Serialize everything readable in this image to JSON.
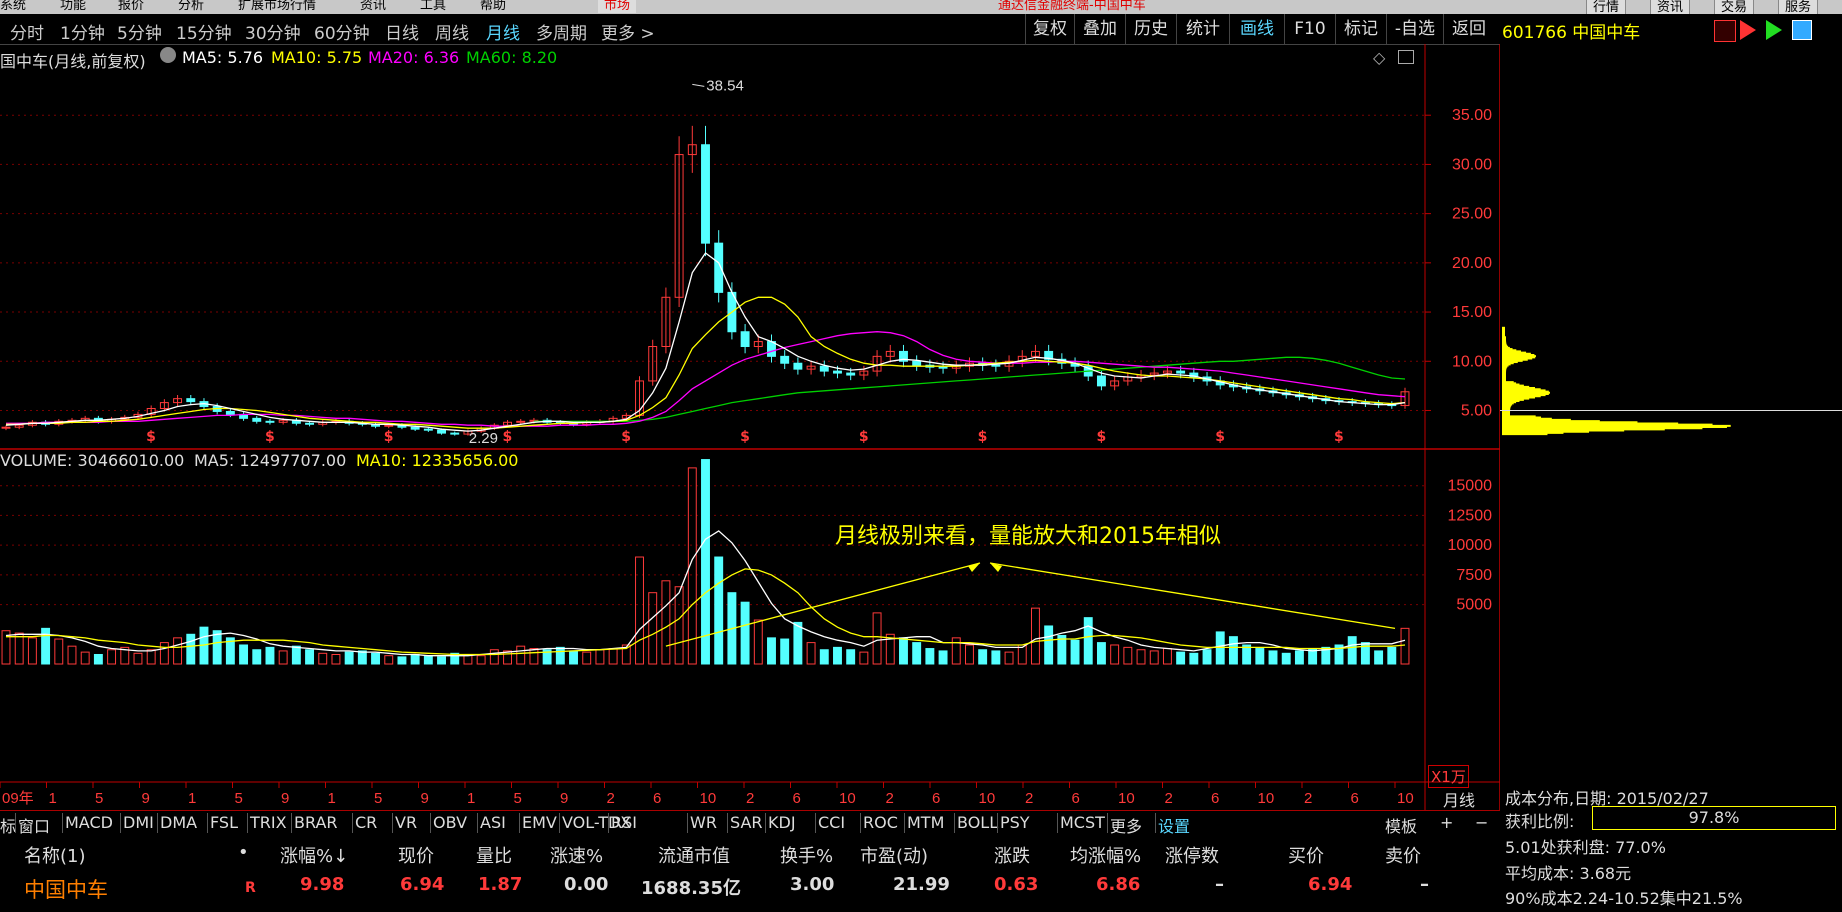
{
  "menu": {
    "items": [
      "系统",
      "功能",
      "报价",
      "分析",
      "扩展市场行情",
      "资讯",
      "工具",
      "帮助"
    ],
    "red_tag": "市场",
    "red_title": "通达信金融终端-中国中车",
    "right_buttons": [
      "行情",
      "资讯",
      "交易",
      "服务"
    ]
  },
  "periods": [
    "分时",
    "1分钟",
    "5分钟",
    "15分钟",
    "30分钟",
    "60分钟",
    "日线",
    "周线",
    "月线",
    "多周期",
    "更多 >"
  ],
  "active_period": "月线",
  "toolbar": [
    "复权",
    "叠加",
    "历史",
    "统计",
    "画线",
    "F10",
    "标记",
    "-自选",
    "返回"
  ],
  "highlighted_tool": "画线",
  "stock": {
    "code": "601766",
    "name": "中国中车",
    "header": "601766 中国中车"
  },
  "price_legend": {
    "title": "国中车(月线,前复权)",
    "ma5": "MA5: 5.76",
    "ma10": "MA10: 5.75",
    "ma20": "MA20: 6.36",
    "ma60": "MA60: 8.20"
  },
  "volume_legend": {
    "vol": "VOLUME: 30466010.00",
    "ma5": "MA5: 12497707.00",
    "ma10": "MA10: 12335656.00"
  },
  "annotation": "月线极别来看，量能放大和2015年相似",
  "volume_unit": "X1万",
  "period_label": "月线",
  "x_axis_labels": [
    "09年",
    "1",
    "5",
    "9",
    "1",
    "5",
    "9",
    "1",
    "5",
    "9",
    "1",
    "5",
    "9",
    "2",
    "6",
    "10",
    "2",
    "6",
    "10",
    "2",
    "6",
    "10",
    "2",
    "6",
    "10",
    "2",
    "6",
    "10",
    "2",
    "6",
    "10"
  ],
  "chart_data": [
    {
      "type": "candlestick",
      "title": "中国中车(月线,前复权)",
      "y_ticks": [
        5,
        10,
        15,
        20,
        25,
        30,
        35
      ],
      "ylim": [
        2,
        40
      ],
      "high_label": "38.54",
      "low_label": "2.29",
      "close": [
        3.3,
        3.5,
        3.8,
        3.6,
        3.9,
        4.0,
        4.2,
        3.9,
        4.1,
        4.3,
        4.6,
        5.2,
        5.8,
        6.2,
        5.9,
        5.4,
        4.9,
        4.6,
        4.2,
        3.9,
        3.8,
        4.0,
        3.7,
        3.6,
        3.8,
        3.9,
        3.7,
        3.6,
        3.4,
        3.5,
        3.3,
        3.1,
        3.0,
        2.7,
        2.6,
        2.9,
        3.2,
        3.5,
        3.8,
        3.9,
        4.0,
        3.8,
        3.7,
        3.6,
        3.8,
        3.9,
        4.2,
        4.5,
        8.0,
        11.5,
        16.5,
        31.0,
        32.0,
        22.0,
        17.0,
        13.0,
        11.5,
        12.0,
        10.5,
        9.8,
        9.2,
        9.5,
        9.0,
        8.8,
        8.6,
        9.0,
        10.5,
        11.0,
        10.0,
        9.6,
        9.4,
        9.3,
        9.5,
        9.8,
        9.6,
        9.5,
        10.0,
        10.5,
        11.0,
        10.2,
        9.8,
        9.5,
        8.5,
        7.5,
        8.0,
        8.4,
        8.6,
        8.8,
        9.0,
        8.8,
        8.4,
        8.0,
        7.6,
        7.4,
        7.2,
        7.0,
        6.8,
        6.6,
        6.4,
        6.2,
        6.0,
        5.9,
        5.8,
        5.7,
        5.6,
        5.5,
        6.9
      ],
      "ma5": [
        3.5,
        3.6,
        3.7,
        3.7,
        3.8,
        3.9,
        4.0,
        4.0,
        4.1,
        4.2,
        4.4,
        4.7,
        5.0,
        5.4,
        5.6,
        5.7,
        5.5,
        5.2,
        4.9,
        4.6,
        4.3,
        4.1,
        4.0,
        3.9,
        3.8,
        3.8,
        3.8,
        3.7,
        3.6,
        3.6,
        3.5,
        3.4,
        3.3,
        3.1,
        3.0,
        2.9,
        3.0,
        3.2,
        3.4,
        3.6,
        3.8,
        3.9,
        3.9,
        3.8,
        3.8,
        3.8,
        3.9,
        4.1,
        5.0,
        6.8,
        9.3,
        14.0,
        19.0,
        21.0,
        20.0,
        17.0,
        14.5,
        12.5,
        12.0,
        11.3,
        10.5,
        10.0,
        9.6,
        9.3,
        9.1,
        9.2,
        9.6,
        10.0,
        10.2,
        10.1,
        9.9,
        9.7,
        9.6,
        9.6,
        9.6,
        9.7,
        9.8,
        10.1,
        10.4,
        10.3,
        10.1,
        9.8,
        9.3,
        8.8,
        8.5,
        8.4,
        8.3,
        8.5,
        8.7,
        8.6,
        8.5,
        8.2,
        7.9,
        7.6,
        7.3,
        7.1,
        6.9,
        6.7,
        6.5,
        6.3,
        6.1,
        5.9,
        5.8,
        5.7,
        5.6,
        5.6,
        5.8
      ],
      "ma10": [
        3.6,
        3.6,
        3.7,
        3.7,
        3.7,
        3.8,
        3.8,
        3.9,
        3.9,
        4.0,
        4.1,
        4.3,
        4.5,
        4.7,
        4.9,
        5.1,
        5.2,
        5.2,
        5.1,
        5.0,
        4.8,
        4.6,
        4.4,
        4.2,
        4.1,
        4.0,
        3.9,
        3.8,
        3.8,
        3.7,
        3.6,
        3.6,
        3.5,
        3.4,
        3.3,
        3.2,
        3.2,
        3.2,
        3.3,
        3.4,
        3.5,
        3.6,
        3.7,
        3.7,
        3.8,
        3.8,
        3.9,
        4.0,
        4.5,
        5.3,
        6.3,
        8.6,
        11.3,
        12.7,
        14.0,
        15.0,
        16.0,
        16.5,
        16.5,
        15.8,
        14.5,
        12.5,
        11.5,
        10.8,
        10.2,
        9.8,
        9.6,
        9.6,
        9.5,
        9.5,
        9.5,
        9.5,
        9.5,
        9.6,
        9.7,
        9.8,
        9.9,
        10.0,
        10.1,
        10.0,
        9.9,
        9.8,
        9.6,
        9.3,
        9.0,
        8.8,
        8.6,
        8.5,
        8.5,
        8.4,
        8.3,
        8.2,
        8.0,
        7.8,
        7.6,
        7.4,
        7.2,
        7.0,
        6.8,
        6.6,
        6.4,
        6.2,
        6.1,
        5.9,
        5.8,
        5.7,
        5.8
      ],
      "ma20": [
        3.7,
        3.7,
        3.7,
        3.8,
        3.8,
        3.8,
        3.8,
        3.8,
        3.9,
        3.9,
        3.9,
        4.0,
        4.1,
        4.2,
        4.3,
        4.4,
        4.5,
        4.5,
        4.6,
        4.6,
        4.6,
        4.5,
        4.5,
        4.4,
        4.3,
        4.2,
        4.2,
        4.1,
        4.0,
        3.9,
        3.9,
        3.8,
        3.7,
        3.6,
        3.6,
        3.5,
        3.5,
        3.4,
        3.4,
        3.4,
        3.4,
        3.4,
        3.5,
        3.5,
        3.5,
        3.6,
        3.6,
        3.7,
        3.9,
        4.3,
        4.9,
        6.0,
        7.2,
        8.0,
        8.8,
        9.6,
        10.2,
        10.6,
        11.0,
        11.4,
        11.7,
        12.0,
        12.3,
        12.6,
        12.8,
        12.9,
        13.0,
        12.9,
        12.6,
        12.0,
        11.2,
        10.6,
        10.2,
        10.0,
        9.9,
        9.8,
        9.8,
        9.8,
        9.9,
        9.9,
        10.0,
        10.0,
        9.9,
        9.8,
        9.7,
        9.6,
        9.5,
        9.4,
        9.4,
        9.3,
        9.2,
        9.1,
        9.0,
        8.8,
        8.6,
        8.4,
        8.2,
        8.0,
        7.8,
        7.6,
        7.4,
        7.2,
        7.0,
        6.8,
        6.6,
        6.5,
        6.4
      ],
      "ma60": [
        null,
        null,
        null,
        null,
        null,
        null,
        null,
        null,
        null,
        null,
        null,
        null,
        null,
        null,
        null,
        null,
        null,
        null,
        null,
        null,
        null,
        null,
        null,
        null,
        null,
        null,
        null,
        null,
        null,
        null,
        null,
        null,
        null,
        null,
        null,
        null,
        null,
        null,
        null,
        null,
        3.9,
        3.9,
        3.9,
        3.9,
        3.9,
        3.9,
        3.9,
        3.9,
        4.0,
        4.1,
        4.3,
        4.6,
        4.9,
        5.2,
        5.5,
        5.8,
        6.0,
        6.2,
        6.4,
        6.6,
        6.8,
        6.9,
        7.0,
        7.1,
        7.2,
        7.3,
        7.4,
        7.5,
        7.6,
        7.7,
        7.8,
        7.9,
        8.0,
        8.1,
        8.2,
        8.3,
        8.4,
        8.5,
        8.6,
        8.7,
        8.8,
        8.9,
        9.0,
        9.1,
        9.2,
        9.3,
        9.4,
        9.5,
        9.6,
        9.7,
        9.8,
        9.9,
        10.0,
        10.0,
        10.1,
        10.2,
        10.3,
        10.4,
        10.4,
        10.3,
        10.1,
        9.8,
        9.4,
        9.0,
        8.6,
        8.3,
        8.2
      ]
    },
    {
      "type": "bar",
      "title": "VOLUME",
      "unit": "X1万",
      "y_ticks": [
        5000,
        7500,
        10000,
        12500,
        15000
      ],
      "ylim": [
        0,
        17500
      ],
      "values": [
        2800,
        2600,
        2200,
        3000,
        2100,
        1500,
        1000,
        800,
        1200,
        1400,
        900,
        1200,
        1800,
        2200,
        2500,
        3100,
        2800,
        2200,
        1600,
        1200,
        1400,
        1100,
        1500,
        1200,
        900,
        800,
        1000,
        1100,
        900,
        700,
        600,
        800,
        700,
        600,
        900,
        800,
        700,
        1200,
        1100,
        1500,
        1300,
        1200,
        1400,
        1100,
        1000,
        1200,
        1300,
        1600,
        9000,
        6000,
        7000,
        6500,
        16500,
        17200,
        9000,
        6000,
        5200,
        3700,
        2200,
        2100,
        3500,
        1800,
        1200,
        1400,
        1200,
        1000,
        4300,
        2500,
        2200,
        1800,
        1300,
        1100,
        2200,
        1600,
        1200,
        1100,
        1000,
        1600,
        4700,
        3200,
        2400,
        2000,
        3900,
        1800,
        1600,
        1400,
        1200,
        1100,
        1300,
        1000,
        900,
        1200,
        2700,
        2300,
        1600,
        1300,
        1100,
        900,
        1100,
        1300,
        1400,
        1600,
        2300,
        1800,
        1100,
        1400,
        3000
      ],
      "ma5": [
        2400,
        2500,
        2500,
        2500,
        2400,
        2200,
        1900,
        1500,
        1300,
        1200,
        1100,
        1100,
        1300,
        1600,
        1900,
        2300,
        2500,
        2600,
        2400,
        2100,
        1700,
        1500,
        1400,
        1300,
        1200,
        1100,
        1100,
        1000,
        1000,
        900,
        800,
        800,
        700,
        700,
        700,
        700,
        800,
        900,
        1000,
        1100,
        1200,
        1300,
        1300,
        1300,
        1200,
        1200,
        1300,
        1400,
        2900,
        3900,
        4900,
        6000,
        8800,
        10500,
        11200,
        10200,
        8700,
        6900,
        5100,
        3800,
        3200,
        2700,
        2300,
        2000,
        1800,
        1500,
        2000,
        2100,
        2200,
        2300,
        2300,
        1800,
        1800,
        1700,
        1600,
        1400,
        1400,
        1400,
        2100,
        2300,
        2600,
        2800,
        3200,
        2700,
        2300,
        2000,
        1600,
        1400,
        1300,
        1200,
        1100,
        1300,
        1500,
        1700,
        1800,
        1800,
        1600,
        1300,
        1200,
        1100,
        1200,
        1300,
        1600,
        1700,
        1700,
        1700,
        2000
      ],
      "ma10": [
        2300,
        2300,
        2300,
        2400,
        2400,
        2300,
        2200,
        2000,
        1900,
        1800,
        1600,
        1500,
        1400,
        1400,
        1500,
        1600,
        1800,
        1900,
        2000,
        2000,
        2000,
        2000,
        1900,
        1800,
        1600,
        1500,
        1400,
        1300,
        1200,
        1100,
        1000,
        950,
        900,
        850,
        800,
        800,
        800,
        800,
        850,
        900,
        950,
        1000,
        1050,
        1100,
        1150,
        1200,
        1250,
        1300,
        2000,
        2500,
        3100,
        3800,
        5000,
        6000,
        6800,
        7500,
        8000,
        7900,
        7500,
        6800,
        6000,
        4800,
        3800,
        3100,
        2600,
        2300,
        2300,
        2200,
        2100,
        2000,
        1900,
        1800,
        1800,
        1800,
        1700,
        1600,
        1600,
        1600,
        1900,
        2000,
        2100,
        2100,
        2300,
        2400,
        2400,
        2300,
        2200,
        2000,
        1800,
        1600,
        1500,
        1400,
        1400,
        1400,
        1400,
        1400,
        1400,
        1400,
        1300,
        1300,
        1300,
        1300,
        1400,
        1500,
        1500,
        1500,
        1600
      ]
    }
  ],
  "indicator_tabs": [
    "标",
    "窗口",
    "MACD",
    "DMI",
    "DMA",
    "FSL",
    "TRIX",
    "BRAR",
    "CR",
    "VR",
    "OBV",
    "ASI",
    "EMV",
    "VOL-TDX",
    "RSI",
    "WR",
    "SAR",
    "KDJ",
    "CCI",
    "ROC",
    "MTM",
    "BOLL",
    "PSY",
    "MCST",
    "更多",
    "设置"
  ],
  "highlighted_indicator": "设置",
  "index_right": {
    "template": "模板",
    "plus": "+",
    "minus": "−"
  },
  "quote_header": [
    "名称(1)",
    "•",
    "涨幅%↓",
    "现价",
    "量比",
    "涨速%",
    "流通市值",
    "换手%",
    "市盈(动)",
    "涨跌",
    "均涨幅%",
    "涨停数",
    "买价",
    "卖价"
  ],
  "quote_row": {
    "name": "中国中车",
    "flag": "R",
    "change_pct": "9.98",
    "price": "6.94",
    "vol_ratio": "1.87",
    "speed": "0.00",
    "float_cap": "1688.35亿",
    "turnover": "3.00",
    "pe": "21.99",
    "change": "0.63",
    "avg_change": "6.86",
    "limit_count": "–",
    "bid": "6.94",
    "ask": "–"
  },
  "cost_panel": {
    "title": "成本分布,日期: 2015/02/27",
    "profit_label": "获利比例:",
    "profit_value": "97.8%",
    "profit_fraction": 0.978,
    "line1": "5.01处获利盘: 77.0%",
    "line2": "平均成本: 3.68元",
    "line3": "90%成本2.24-10.52集中21.5%"
  },
  "colors": {
    "up": "#ff3a3a",
    "down": "#54ffff",
    "ma5": "#ffffff",
    "ma10": "#ffff00",
    "ma20": "#ff00ff",
    "ma60": "#00d000",
    "axis": "#c00000",
    "accent": "#5ad7ff",
    "chip": "#ffff00"
  }
}
